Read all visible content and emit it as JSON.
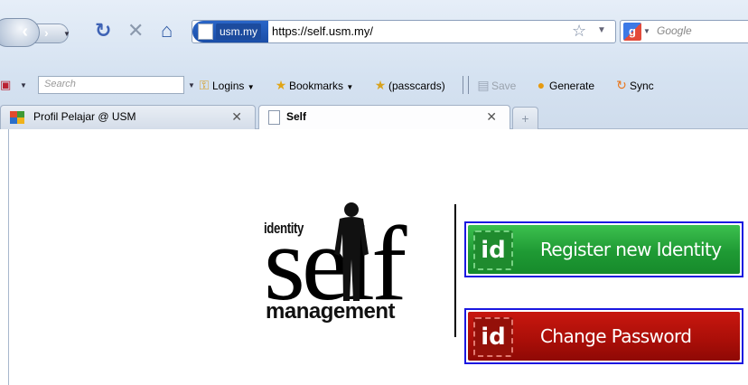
{
  "navbar": {
    "back_icon": "back-arrow-icon",
    "forward_icon": "forward-arrow-icon",
    "reload_icon": "reload-icon",
    "stop_icon": "stop-icon",
    "home_icon": "home-icon",
    "identity_label": "usm.my",
    "url": "https://self.usm.my/",
    "search_placeholder": "Google"
  },
  "toolbar": {
    "search_placeholder": "Search",
    "items": [
      {
        "label": "Logins",
        "icon": "key-icon"
      },
      {
        "label": "Bookmarks",
        "icon": "star-icon"
      },
      {
        "label": "(passcards)",
        "icon": "passcard-icon"
      },
      {
        "label": "Save",
        "icon": "save-icon",
        "disabled": true
      },
      {
        "label": "Generate",
        "icon": "generate-icon"
      },
      {
        "label": "Sync",
        "icon": "sync-icon"
      }
    ]
  },
  "tabs": [
    {
      "label": "Profil Pelajar @ USM",
      "active": false
    },
    {
      "label": "Self",
      "active": true
    }
  ],
  "page": {
    "logo": {
      "word_identity": "identity",
      "word_self": "self",
      "word_management": "management"
    },
    "buttons": {
      "register": {
        "badge": "id",
        "label": "Register new Identity",
        "color": "#1f9a34"
      },
      "change_password": {
        "badge": "id",
        "label": "Change Password",
        "color": "#a90e08"
      }
    },
    "button_border_color": "#1b18e0"
  }
}
